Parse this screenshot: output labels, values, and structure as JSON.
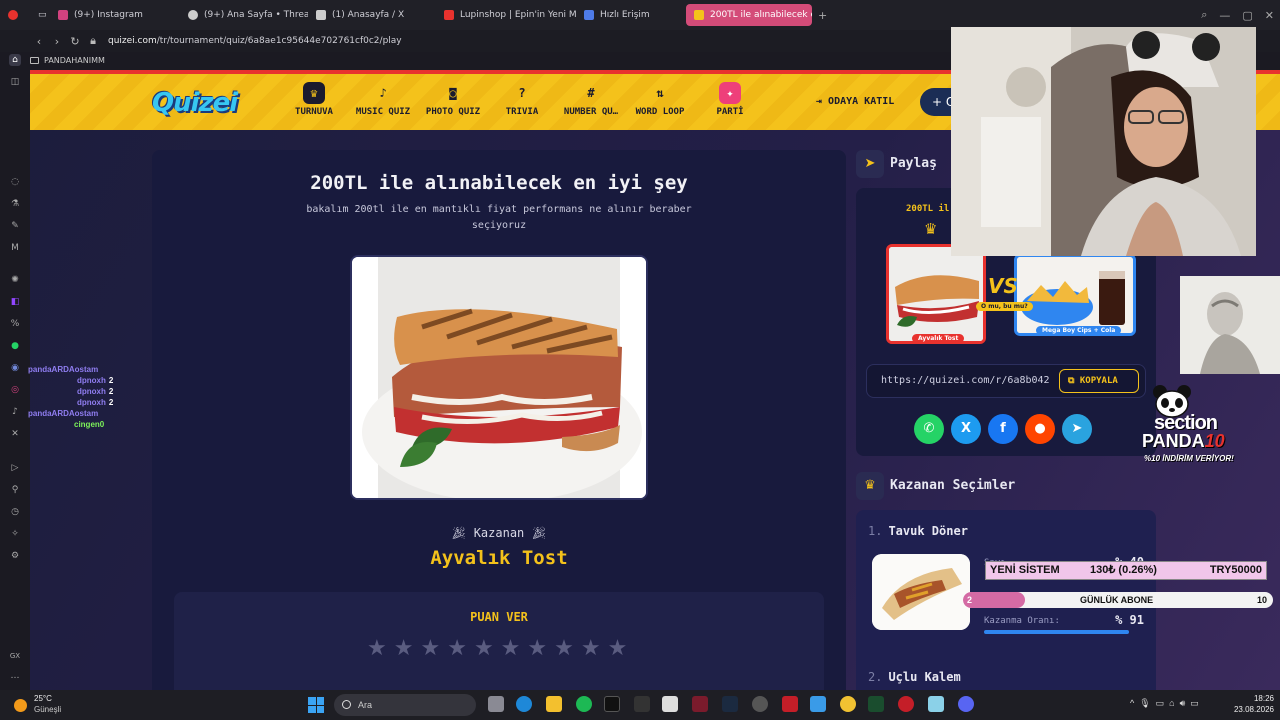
{
  "browser": {
    "tabs": [
      {
        "label": "(9+) Instagram",
        "color": "#d2427f"
      },
      {
        "label": "(9+) Ana Sayfa • Threads",
        "color": "#cccccc"
      },
      {
        "label": "(1) Anasayfa / X",
        "color": "#cccccc"
      },
      {
        "label": "Lupinshop | Epin'in Yeni Me",
        "color": "#e8322e"
      },
      {
        "label": "Hızlı Erişim",
        "color": "#4e7be8"
      },
      {
        "label": "200TL ile alınabilecek en iy",
        "color": "#f4c21b"
      }
    ],
    "url_host": "quizei.com",
    "url_path": "/tr/tournament/quiz/6a8ae1c95644e702761cf0c2/play",
    "bookmark_folder": "PANDAHANIMM"
  },
  "site": {
    "logo": "Quizei",
    "nav": [
      {
        "label": "TURNUVA",
        "icon": "trophy",
        "glyph": "♛"
      },
      {
        "label": "MUSIC QUIZ",
        "icon": "music",
        "glyph": "♪"
      },
      {
        "label": "PHOTO QUIZ",
        "icon": "camera",
        "glyph": "◙"
      },
      {
        "label": "TRIVIA",
        "icon": "question",
        "glyph": "?"
      },
      {
        "label": "NUMBER QU…",
        "icon": "hash",
        "glyph": "#"
      },
      {
        "label": "WORD LOOP",
        "icon": "sort",
        "glyph": "⇅"
      },
      {
        "label": "PARTİ",
        "icon": "party",
        "glyph": "✦"
      }
    ],
    "join_label": "ODAYA KATIL",
    "create_label": "+ O"
  },
  "quiz": {
    "title": "200TL ile alınabilecek en iyi şey",
    "description": "bakalım 200tl ile en mantıklı fiyat performans ne alınır beraber seçiyoruz",
    "winner_label": "Kazanan",
    "winner_name": "Ayvalık Tost",
    "rate_title": "PUAN VER",
    "stars_total": 10,
    "stars_filled": 0
  },
  "share": {
    "title": "Paylaş",
    "preview_title": "200TL il",
    "vs_question": "O mu, bu mu?",
    "left_caption": "Ayvalık Tost",
    "right_caption": "Mega Boy Cips + Cola",
    "link": "https://quizei.com/r/6a8b042",
    "copy_label": "KOPYALA",
    "socials": [
      {
        "name": "whatsapp",
        "glyph": "✆",
        "color": "#25d366"
      },
      {
        "name": "x",
        "glyph": "X",
        "color": "#1d9bf0"
      },
      {
        "name": "facebook",
        "glyph": "f",
        "color": "#1877f2"
      },
      {
        "name": "reddit",
        "glyph": "●",
        "color": "#ff4500"
      },
      {
        "name": "telegram",
        "glyph": "➤",
        "color": "#2aa3df"
      }
    ]
  },
  "winners": {
    "title": "Kazanan Seçimler",
    "items": [
      {
        "rank": "1.",
        "name": "Tavuk Döner",
        "row1_label": "Sayı…",
        "row1_pct": "% 40",
        "win_label": "Kazanma Oranı:",
        "win_pct": "% 91"
      },
      {
        "rank": "2.",
        "name": "Uçlu Kalem"
      }
    ]
  },
  "stream": {
    "chat": [
      {
        "user": "pandaARDAostam",
        "msg": "",
        "color": "#8f7df0"
      },
      {
        "user": "dpnoxh",
        "msg": "2",
        "color": "#8f7df0"
      },
      {
        "user": "dpnoxh",
        "msg": "2",
        "color": "#8f7df0"
      },
      {
        "user": "dpnoxh",
        "msg": "2",
        "color": "#8f7df0"
      },
      {
        "user": "pandaARDAostam",
        "msg": "",
        "color": "#8f7df0"
      },
      {
        "user": "cingen0",
        "msg": "",
        "color": "#7cf25a"
      }
    ],
    "ad_brand": "section",
    "ad_name": "PANDA",
    "ad_code": "10",
    "ad_tagline": "%10 İNDİRİM VERİYOR!",
    "ticker_left": "YENİ SİSTEM",
    "ticker_mid": "130₺ (0.26%)",
    "ticker_right": "TRY50000",
    "goal_current": "2",
    "goal_label": "GÜNLÜK ABONE",
    "goal_target": "10"
  },
  "taskbar": {
    "temp": "25°C",
    "weather": "Güneşli",
    "search": "Ara",
    "time": "18:26",
    "date": "23.08.2026"
  }
}
